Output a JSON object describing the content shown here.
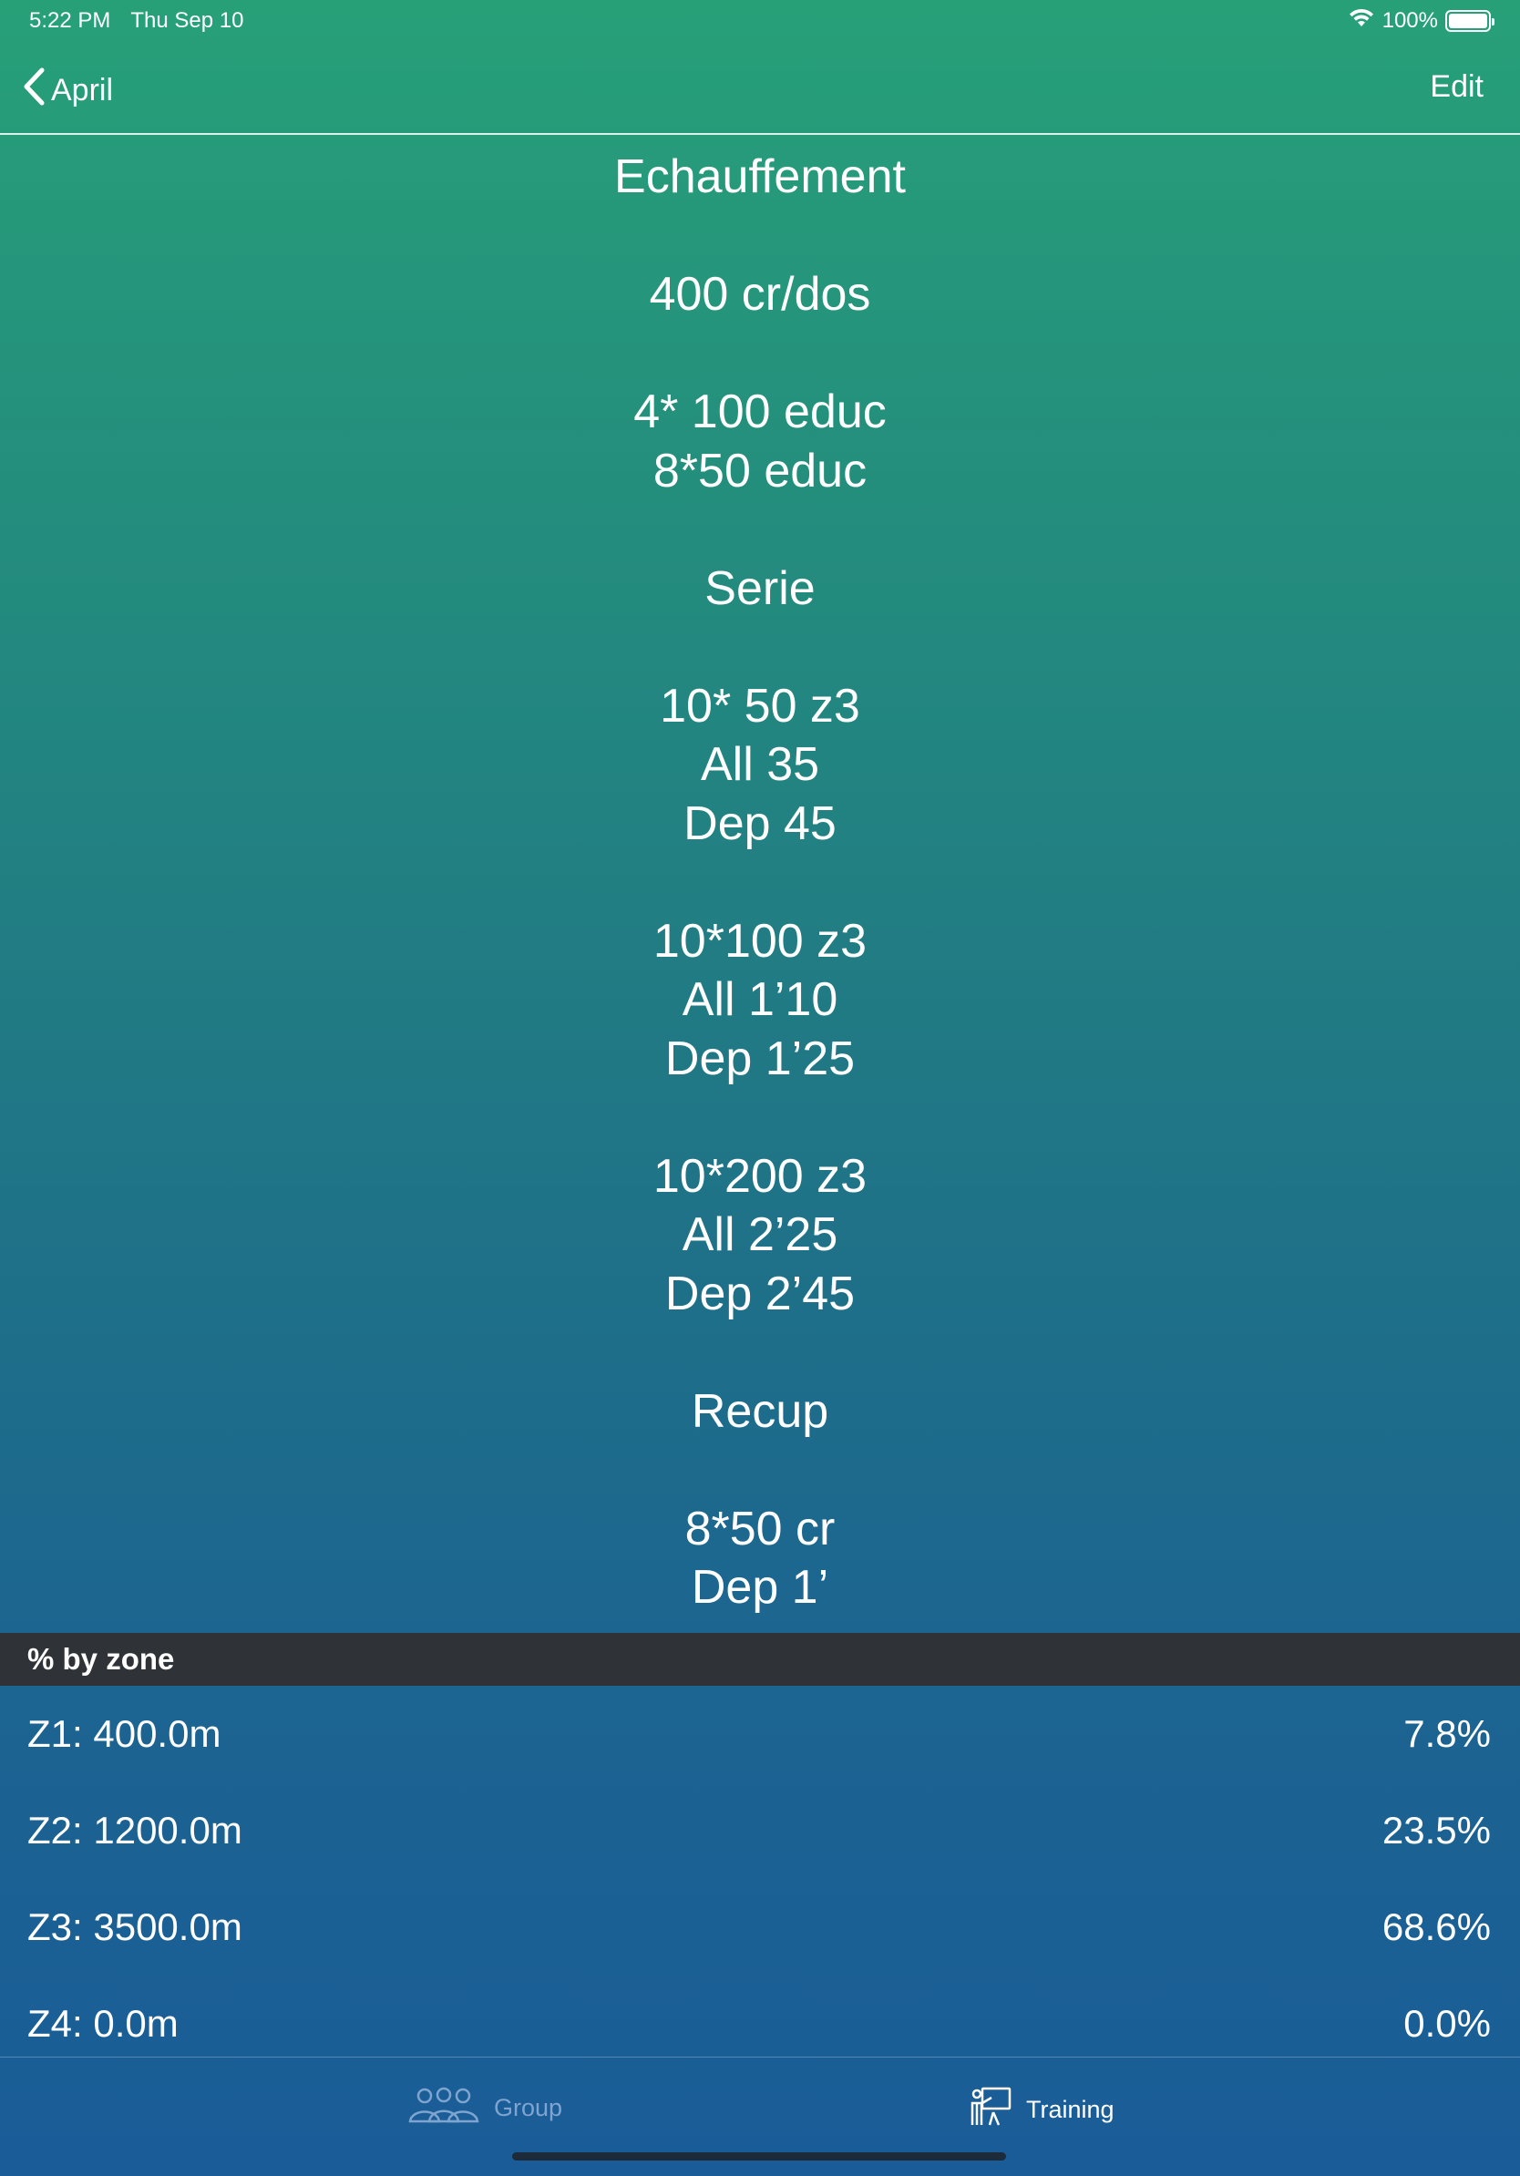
{
  "status_bar": {
    "time": "5:22 PM",
    "date": "Thu Sep 10",
    "battery": "100%",
    "battery_level": 1.0
  },
  "nav": {
    "back_label": "April",
    "edit_label": "Edit"
  },
  "workout": {
    "lines": [
      "Echauffement",
      "",
      "400 cr/dos",
      "",
      "4* 100 educ",
      "8*50 educ",
      "",
      "Serie",
      "",
      "10* 50 z3",
      "All 35",
      "Dep 45",
      "",
      "10*100 z3",
      "All 1’10",
      "Dep 1’25",
      "",
      "10*200 z3",
      "All 2’25",
      "Dep 2’45",
      "",
      "Recup",
      "",
      "8*50 cr",
      "Dep 1’"
    ]
  },
  "zones": {
    "header": "% by zone",
    "rows": [
      {
        "label": "Z1: 400.0m",
        "percent": "7.8%"
      },
      {
        "label": "Z2: 1200.0m",
        "percent": "23.5%"
      },
      {
        "label": "Z3: 3500.0m",
        "percent": "68.6%"
      },
      {
        "label": "Z4: 0.0m",
        "percent": "0.0%"
      }
    ]
  },
  "tabs": [
    {
      "label": "Group",
      "icon": "group-icon",
      "selected": false
    },
    {
      "label": "Training",
      "icon": "training-icon",
      "selected": true
    }
  ],
  "colors": {
    "gradient_top": "#27a078",
    "gradient_bottom": "#1a5c98",
    "section_header": "#2f3236",
    "tab_inactive": "#7fa4cf",
    "tab_active": "#ffffff"
  }
}
